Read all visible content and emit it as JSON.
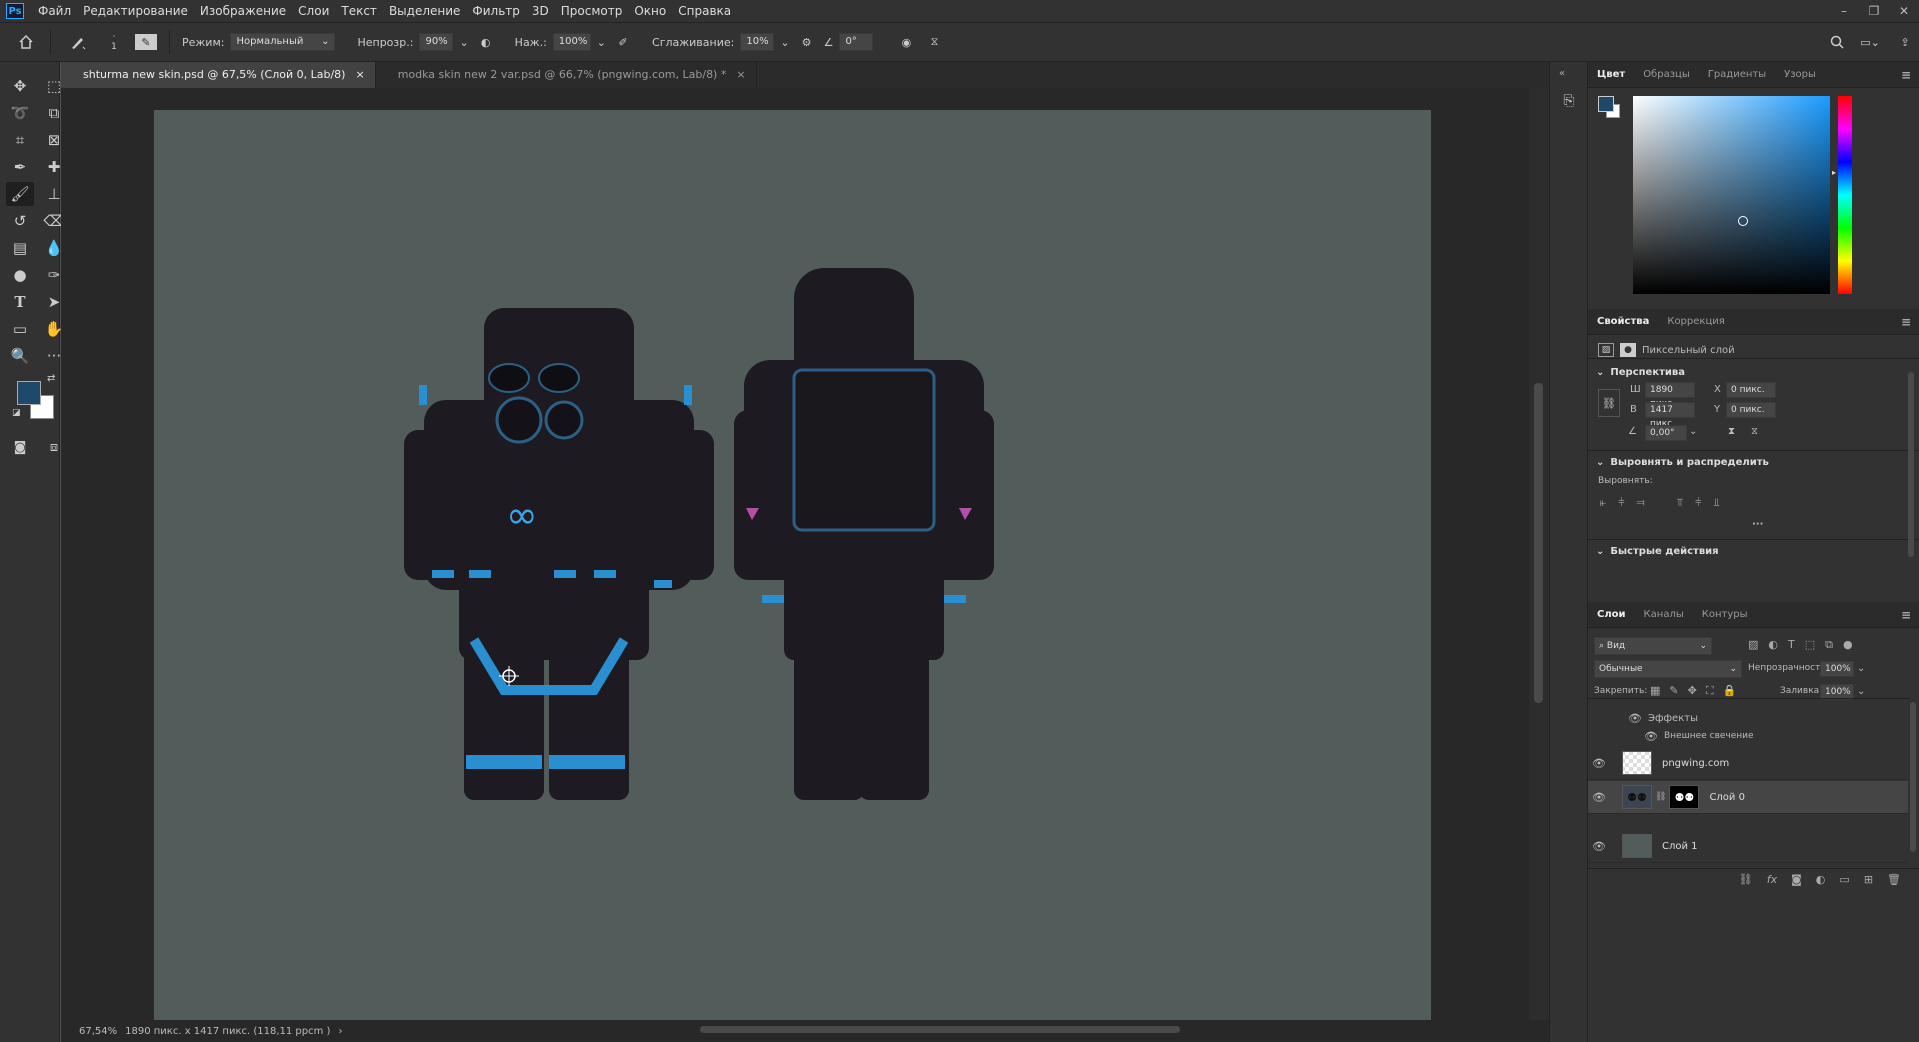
{
  "menubar": {
    "app_icon": "Ps",
    "items": [
      "Файл",
      "Редактирование",
      "Изображение",
      "Слои",
      "Текст",
      "Выделение",
      "Фильтр",
      "3D",
      "Просмотр",
      "Окно",
      "Справка"
    ],
    "window_controls": [
      "–",
      "❐",
      "✕"
    ]
  },
  "options": {
    "brush_size": "1",
    "mode_label": "Режим:",
    "mode_value": "Нормальный",
    "opacity_label": "Непрозр.:",
    "opacity_value": "90%",
    "pressure_label": "Наж.:",
    "pressure_value": "100%",
    "smoothing_label": "Сглаживание:",
    "smoothing_value": "10%",
    "angle_value": "0°"
  },
  "tabs": [
    {
      "label": "shturma new skin.psd @ 67,5% (Слой 0, Lab/8)",
      "close": "×"
    },
    {
      "label": "modka skin new 2 var.psd @ 66,7% (pngwing.com, Lab/8) *",
      "close": "×"
    }
  ],
  "status": {
    "zoom": "67,54%",
    "doc_info": "1890 пикс. x 1417 пикс. (118,11 ppcm )",
    "arrow": "›"
  },
  "colors": {
    "foreground": "#1d4a6b",
    "background": "#ffffff",
    "canvas_bg": "#525c5b",
    "accent_blue": "#2a8fd0"
  },
  "color_panel": {
    "tabs": [
      "Цвет",
      "Образцы",
      "Градиенты",
      "Узоры"
    ],
    "active": "Цвет"
  },
  "properties_panel": {
    "tabs": [
      "Свойства",
      "Коррекция"
    ],
    "active": "Свойства",
    "layer_type": "Пиксельный слой",
    "perspective_title": "Перспектива",
    "w_label": "Ш",
    "w_value": "1890 пикс",
    "h_label": "В",
    "h_value": "1417 пикс",
    "x_label": "X",
    "x_value": "0 пикс.",
    "y_label": "Y",
    "y_value": "0 пикс.",
    "angle_value": "0,00°",
    "align_title": "Выровнять и распределить",
    "align_label": "Выровнять:",
    "more": "···",
    "quick_title": "Быстрые действия"
  },
  "layers_panel": {
    "tabs": [
      "Слои",
      "Каналы",
      "Контуры"
    ],
    "active": "Слои",
    "filter_value": "Вид",
    "blend_mode": "Обычные",
    "opacity_label": "Непрозрачность:",
    "opacity_value": "100%",
    "lock_label": "Закрепить:",
    "fill_label": "Заливка:",
    "fill_value": "100%",
    "effects_label": "Эффекты",
    "outer_glow_label": "Внешнее свечение",
    "layers": [
      {
        "name": "pngwing.com"
      },
      {
        "name": "Слой 0",
        "selected": true
      },
      {
        "name": "Слой 1"
      }
    ],
    "bottom_icons": [
      "link-icon",
      "fx-icon",
      "mask-icon",
      "adjustment-icon",
      "folder-icon",
      "new-layer-icon",
      "trash-icon"
    ]
  }
}
